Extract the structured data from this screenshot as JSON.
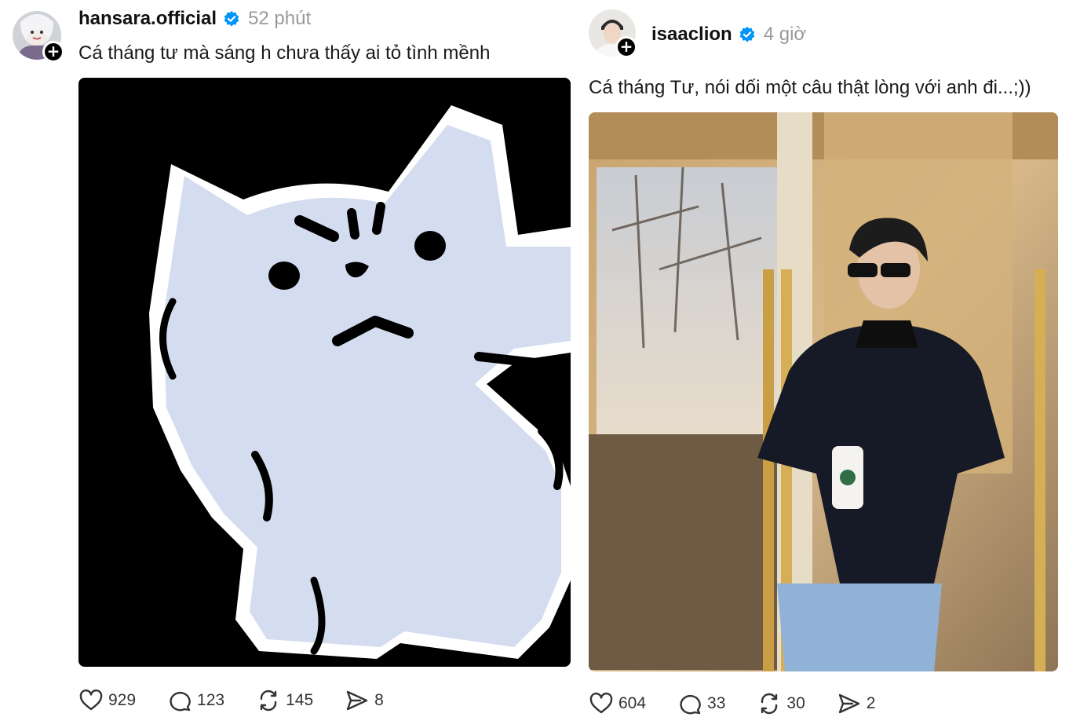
{
  "posts": [
    {
      "username": "hansara.official",
      "time": "52 phút",
      "caption": "Cá tháng tư mà sáng h chưa thấy ai tỏ tình mềnh",
      "stats": {
        "likes": "929",
        "comments": "123",
        "reposts": "145",
        "shares": "8"
      }
    },
    {
      "username": "isaaclion",
      "time": "4 giờ",
      "caption": "Cá tháng Tư, nói dối một câu thật lòng với anh đi...;))",
      "stats": {
        "likes": "604",
        "comments": "33",
        "reposts": "30",
        "shares": "2"
      }
    }
  ],
  "colors": {
    "verified": "#0095f6",
    "muted": "#9a9a9a",
    "text": "#1a1a1a",
    "cat_fill": "#d4dcf0"
  },
  "icons": [
    "verified-badge-icon",
    "heart-icon",
    "comment-icon",
    "repost-icon",
    "share-icon",
    "plus-icon"
  ]
}
